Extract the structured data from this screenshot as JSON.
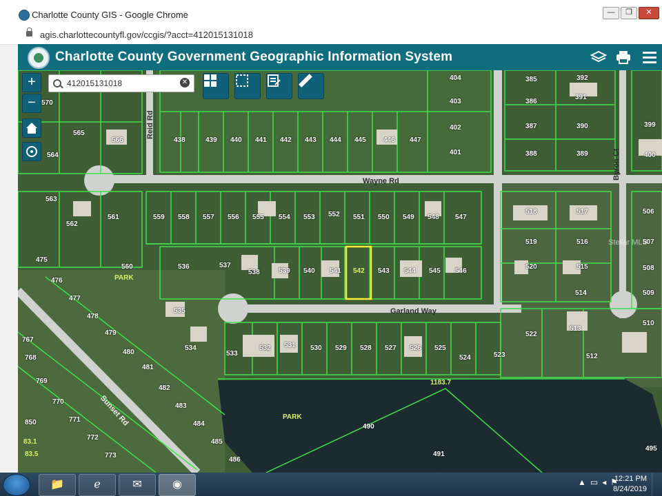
{
  "browser": {
    "window_title": "Charlotte County GIS - Google Chrome",
    "url": "agis.charlottecountyfl.gov/ccgis/?acct=412015131018",
    "minimize_label": "—",
    "restore_label": "❐",
    "close_label": "✕"
  },
  "app": {
    "title": "Charlotte County Government Geographic Information System",
    "layers_icon": "layers-icon",
    "print_icon": "printer-icon",
    "menu_icon": "menu-icon"
  },
  "search": {
    "value": "412015131018",
    "placeholder": ""
  },
  "map_controls": {
    "zoom_in": "+",
    "zoom_out": "−",
    "home_icon": "home-icon",
    "locate_icon": "locate-icon"
  },
  "toolbar": {
    "tools": [
      "grid-tool-icon",
      "select-tool-icon",
      "edit-tool-icon",
      "measure-tool-icon"
    ]
  },
  "map": {
    "roads": [
      "Wayne Rd",
      "Garland Way",
      "Byron Ct",
      "Sunset Rd",
      "Reid Rd"
    ],
    "park_labels": [
      "PARK",
      "PARK"
    ],
    "lots_row1": [
      "570",
      "565",
      "566",
      "438",
      "439",
      "440",
      "441",
      "442",
      "443",
      "444",
      "445",
      "446",
      "447",
      "404",
      "403",
      "402",
      "401",
      "385",
      "386",
      "387",
      "388",
      "389",
      "390",
      "391",
      "392",
      "399",
      "400"
    ],
    "lots_row2": [
      "564",
      "563",
      "562",
      "561",
      "559",
      "558",
      "557",
      "556",
      "555",
      "554",
      "553",
      "552",
      "551",
      "550",
      "549",
      "548",
      "547",
      "518",
      "517",
      "519",
      "516",
      "520",
      "515",
      "506",
      "507",
      "508",
      "509"
    ],
    "lots_row3": [
      "475",
      "476",
      "477",
      "478",
      "479",
      "560",
      "536",
      "537",
      "538",
      "539",
      "540",
      "541",
      "542",
      "543",
      "544",
      "545",
      "546",
      "535",
      "514",
      "513",
      "512",
      "510"
    ],
    "lots_row4": [
      "767",
      "768",
      "769",
      "770",
      "771",
      "772",
      "773",
      "480",
      "481",
      "482",
      "483",
      "484",
      "485",
      "486",
      "534",
      "533",
      "532",
      "531",
      "530",
      "529",
      "528",
      "527",
      "526",
      "525",
      "524",
      "523",
      "522"
    ],
    "lots_other": [
      "850",
      "83.1",
      "83.5",
      "490",
      "491",
      "495",
      "1183.7"
    ],
    "selected_lot": "542",
    "watermark": "Stellar MLS"
  },
  "taskbar": {
    "time": "12:21 PM",
    "date": "8/24/2019"
  }
}
